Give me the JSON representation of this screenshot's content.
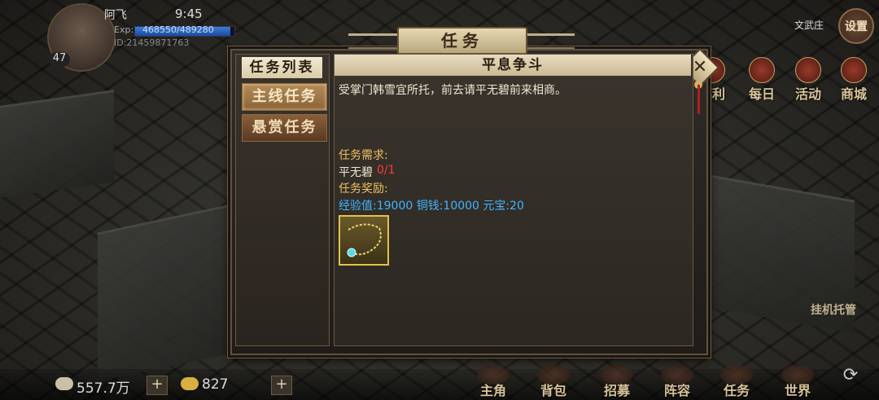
{
  "hud": {
    "player_name": "阿飞",
    "clock": "9:45",
    "level": "47",
    "exp_label": "Exp:",
    "exp_value": "468550/489280",
    "exp_progress": 0.958,
    "player_id": "ID:21459871763",
    "zone_name": "文武庄",
    "settings_label": "设置"
  },
  "side_icons": [
    "福利",
    "每日",
    "活动",
    "商城"
  ],
  "afk_label": "挂机托管",
  "currency": {
    "copper": "557.7万",
    "gold": "827"
  },
  "bottom_nav": [
    "主角",
    "背包",
    "招募",
    "阵容",
    "任务",
    "世界"
  ],
  "dialog": {
    "title": "任务",
    "list_title": "任务列表",
    "tabs": [
      "主线任务",
      "悬赏任务"
    ],
    "active_tab": 0,
    "quest": {
      "title": "平息争斗",
      "description": "受掌门韩雪宜所托，前去请平无碧前来相商。",
      "requirement_label": "任务需求:",
      "requirement_target": "平无碧",
      "requirement_progress": "0/1",
      "reward_label": "任务奖励:",
      "reward_text": "经验值:19000 铜钱:10000 元宝:20",
      "reward_item_icon": "jade-necklace-icon"
    }
  },
  "colors": {
    "accent_gold": "#e4c24a",
    "reward_blue": "#3fb6ff",
    "progress_red": "#ff3a3a",
    "label_yellow": "#f0c060"
  }
}
